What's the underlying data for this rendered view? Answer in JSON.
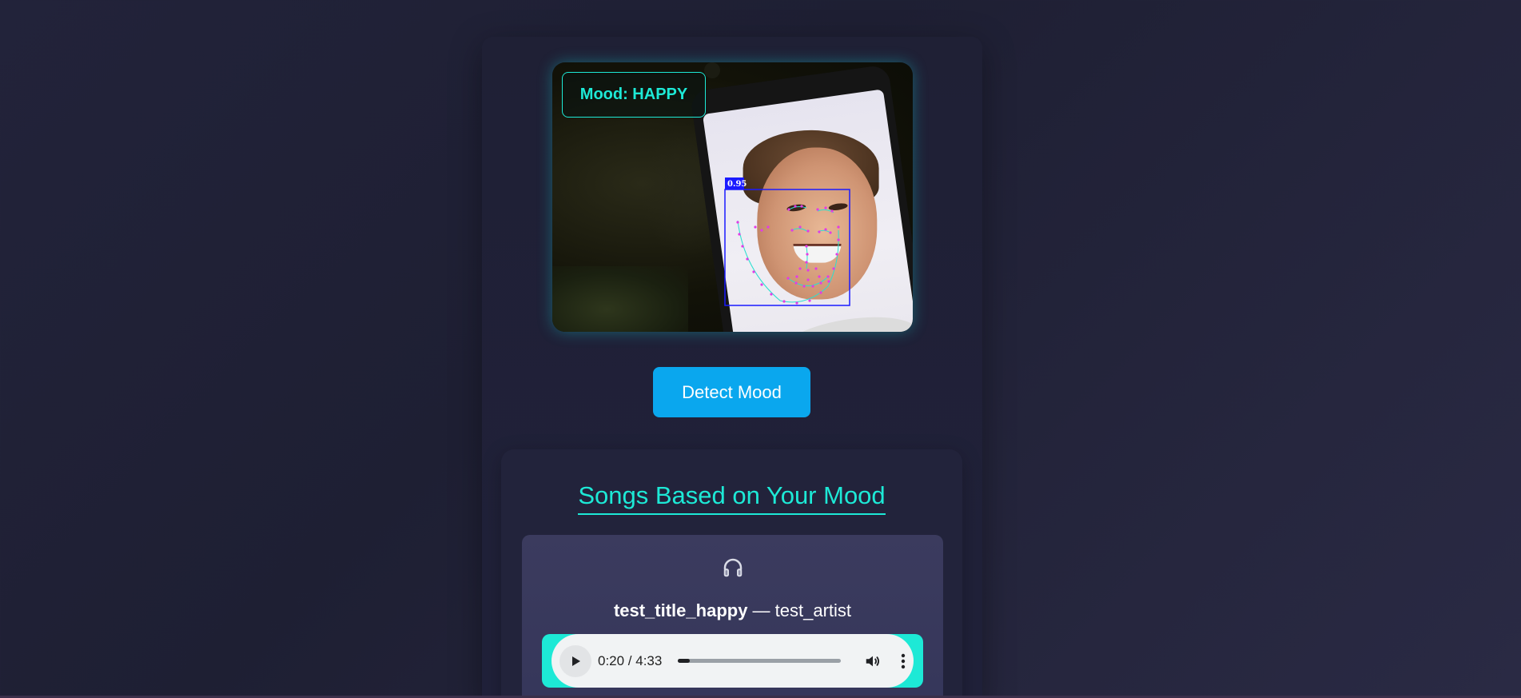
{
  "camera": {
    "mood_badge": "Mood: HAPPY",
    "detection_score": "0.95"
  },
  "actions": {
    "detect_label": "Detect Mood"
  },
  "songs": {
    "heading": "Songs Based on Your Mood",
    "items": [
      {
        "title": "test_title_happy",
        "separator": " — ",
        "artist": "test_artist",
        "icon": "headphones-icon",
        "player": {
          "time": "0:20 / 4:33",
          "progress": 0.073
        }
      }
    ]
  },
  "colors": {
    "accent": "#1de9d6",
    "button": "#0aa7ee",
    "background": "#22233a"
  }
}
